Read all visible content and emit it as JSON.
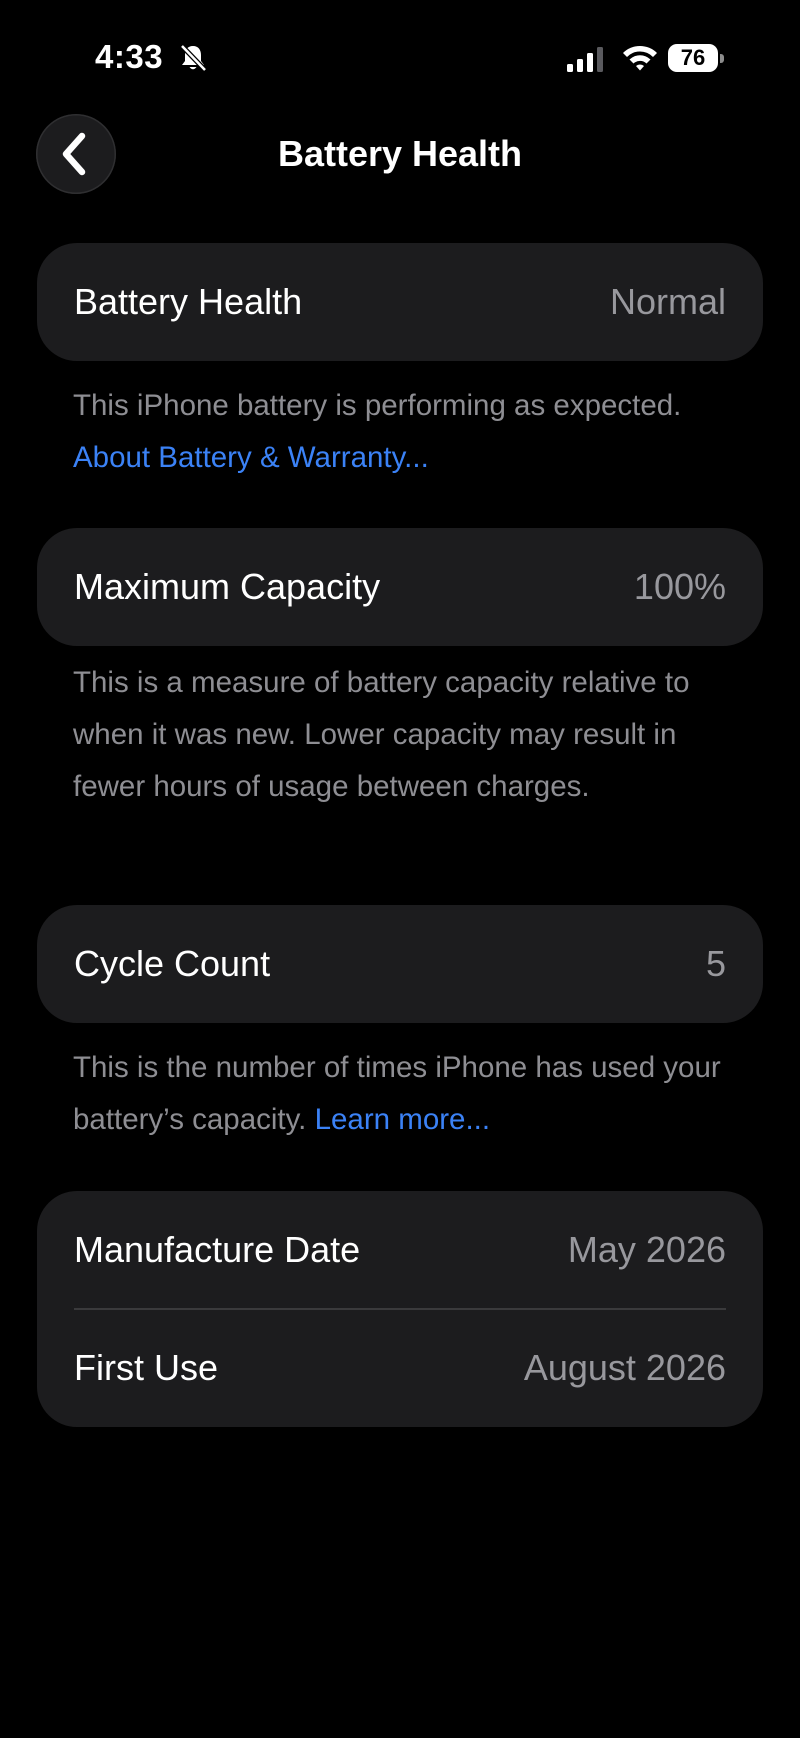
{
  "status_bar": {
    "time": "4:33",
    "battery_level": "76",
    "icons": [
      "bell-slash-icon",
      "cellular-signal-icon",
      "wifi-icon",
      "battery-icon"
    ]
  },
  "nav": {
    "back_icon": "chevron-left-icon",
    "title": "Battery Health"
  },
  "battery_health": {
    "label": "Battery Health",
    "value": "Normal",
    "description": "This iPhone battery is performing as expected.",
    "link": "About Battery & Warranty..."
  },
  "maximum_capacity": {
    "label": "Maximum Capacity",
    "value": "100%",
    "description": "This is a measure of battery capacity relative to when it was new. Lower capacity may result in fewer hours of usage between charges."
  },
  "cycle_count": {
    "label": "Cycle Count",
    "value": "5",
    "description": "This is the number of times iPhone has used your battery’s capacity.",
    "link": "Learn more..."
  },
  "dates": {
    "manufacture_label": "Manufacture Date",
    "manufacture_value": "May 2026",
    "first_use_label": "First Use",
    "first_use_value": "August 2026"
  },
  "colors": {
    "background": "#000000",
    "card": "#1c1c1e",
    "secondary_text": "#8e8e93",
    "link": "#3b82f6"
  }
}
